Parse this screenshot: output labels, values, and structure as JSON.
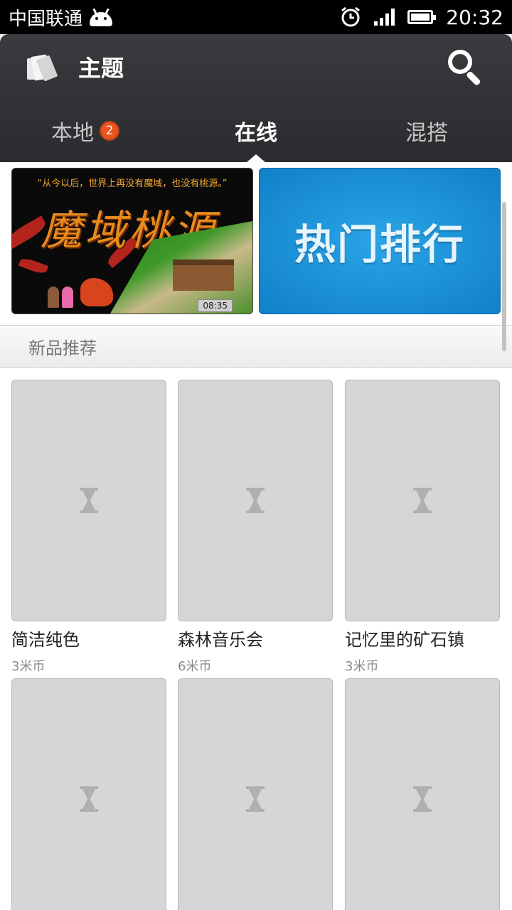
{
  "status_bar": {
    "carrier": "中国联通",
    "time": "20:32",
    "icons": [
      "android-icon",
      "alarm-icon",
      "signal-icon",
      "battery-icon"
    ]
  },
  "header": {
    "title": "主题",
    "icons": [
      "theme-icon",
      "search-icon"
    ]
  },
  "tabs": [
    {
      "label": "本地",
      "badge": "2"
    },
    {
      "label": "在线",
      "active": true
    },
    {
      "label": "混搭"
    }
  ],
  "banners": {
    "game": {
      "slogan": "“从今以后，世界上再没有魔域，也没有桃源。”",
      "title": "魔域桃源",
      "clock": "08:35"
    },
    "hot": {
      "text": "热门排行"
    }
  },
  "section": {
    "title": "新品推荐"
  },
  "items": [
    {
      "name": "简洁纯色",
      "price": "3米币"
    },
    {
      "name": "森林音乐会",
      "price": "6米币"
    },
    {
      "name": "记忆里的矿石镇",
      "price": "3米币"
    },
    {
      "name": "",
      "price": ""
    },
    {
      "name": "",
      "price": ""
    },
    {
      "name": "",
      "price": ""
    }
  ],
  "colors": {
    "header_bg": "#2f3033",
    "badge": "#e8531e",
    "hot_banner": "#1a92d8"
  }
}
